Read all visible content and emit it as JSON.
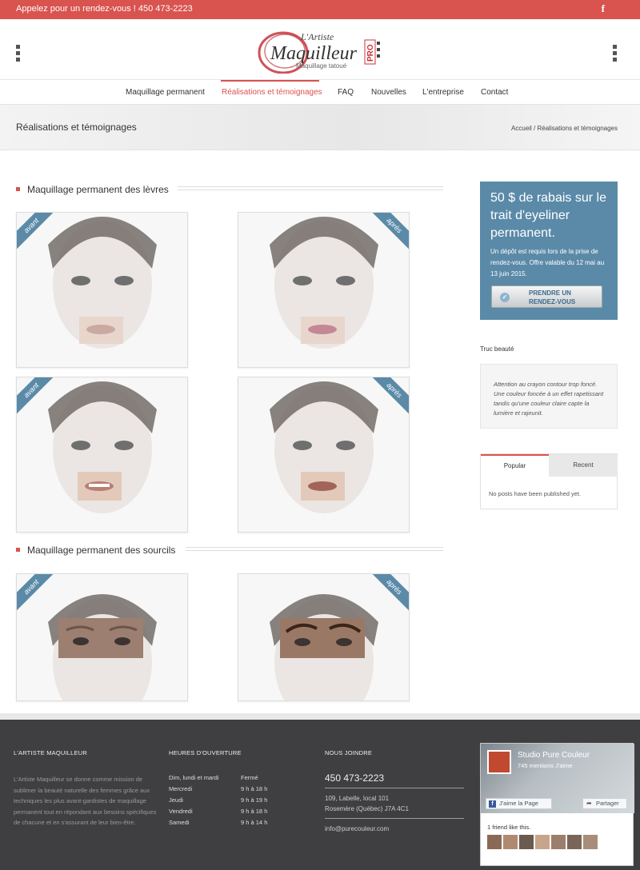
{
  "topbar": {
    "phone": "Appelez pour un rendez-vous ! 450 473-2223",
    "facebook_icon": "facebook-icon"
  },
  "logo": {
    "line1": "L'Artiste",
    "line2": "Maquilleur",
    "badge": "PRO",
    "tagline": "Maquillage tatoué"
  },
  "nav": {
    "items": [
      {
        "label": "Maquillage permanent"
      },
      {
        "label": "Réalisations et témoignages"
      },
      {
        "label": "FAQ"
      },
      {
        "label": "Nouvelles"
      },
      {
        "label": "L'entreprise"
      },
      {
        "label": "Contact"
      }
    ],
    "active_index": 1
  },
  "banner": {
    "title": "Réalisations et témoignages",
    "breadcrumb": "Accueil  /  Réalisations et témoignages"
  },
  "sections": [
    {
      "title": "Maquillage permanent des lèvres",
      "cards": [
        {
          "ribbon": "avant"
        },
        {
          "ribbon": "après"
        },
        {
          "ribbon": "avant"
        },
        {
          "ribbon": "après"
        }
      ]
    },
    {
      "title": "Maquillage permanent des sourcils",
      "cards": [
        {
          "ribbon": "avant"
        },
        {
          "ribbon": "après"
        }
      ]
    }
  ],
  "promo": {
    "headline": "50 $ de rabais sur le trait d'eyeliner permanent.",
    "text": "Un dépôt est requis lors de la prise de rendez-vous. Offre valable du 12 mai au 13 juin 2015.",
    "button_line1": "PRENDRE UN",
    "button_line2": "RENDEZ-VOUS"
  },
  "tip": {
    "title": "Truc beauté",
    "text": "Attention au crayon contour trop foncé. Une couleur foncée à un effet rapetissant tandis qu'une couleur claire capte la lumière et rajeunit."
  },
  "tabs": {
    "popular": "Popular",
    "recent": "Recent",
    "message": "No posts have been published yet."
  },
  "footer": {
    "about_title": "L'ARTISTE MAQUILLEUR",
    "about_text": "L'Artiste Maquilleur se donne comme mission de sublimer la beauté naturelle des femmes grâce aux techniques les plus avant-gardistes de maquillage permanent tout en répondant aux besoins spécifiques de chacune et en s'assurant de leur bien-être.",
    "hours_title": "HEURES D'OUVERTURE",
    "hours": [
      {
        "day": "Dim, lundi et mardi",
        "time": "Fermé"
      },
      {
        "day": "Mercredi",
        "time": "9 h à 18 h"
      },
      {
        "day": "Jeudi",
        "time": "9 h à 19 h"
      },
      {
        "day": "Vendredi",
        "time": "9 h à 18 h"
      },
      {
        "day": "Samedi",
        "time": "9 h à 14 h"
      }
    ],
    "contact_title": "NOUS JOINDRE",
    "phone": "450 473-2223",
    "address1": "109, Labelle, local 101",
    "address2": "Rosemère (Québec) J7A 4C1",
    "email": "info@purecouleur.com"
  },
  "facebook": {
    "page_name": "Studio Pure Couleur",
    "likes": "745 mentions J'aime",
    "like_button": "J'aime la Page",
    "share_button": "Partager",
    "friends": "1 friend like this."
  },
  "colors": {
    "accent": "#d9534f",
    "promo": "#5b8aa8",
    "footer": "#3f3f41"
  }
}
